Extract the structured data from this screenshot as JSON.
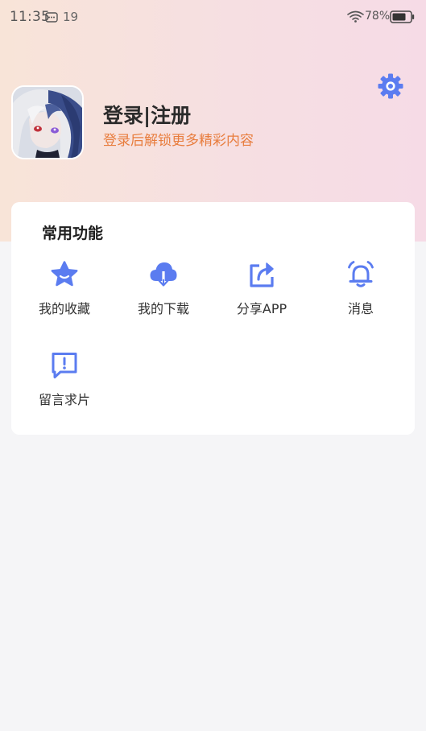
{
  "status_bar": {
    "time": "11:35",
    "notification_count": "19",
    "battery": "78%"
  },
  "colors": {
    "accent": "#5b7cf0",
    "subtitle": "#e87d3e"
  },
  "profile": {
    "title": "登录|注册",
    "subtitle": "登录后解锁更多精彩内容",
    "settings_icon": "gear-icon"
  },
  "common_functions": {
    "title": "常用功能",
    "items": [
      {
        "label": "我的收藏",
        "icon": "star-icon"
      },
      {
        "label": "我的下载",
        "icon": "cloud-download-icon"
      },
      {
        "label": "分享APP",
        "icon": "share-icon"
      },
      {
        "label": "消息",
        "icon": "bell-icon"
      },
      {
        "label": "留言求片",
        "icon": "feedback-icon"
      }
    ]
  }
}
